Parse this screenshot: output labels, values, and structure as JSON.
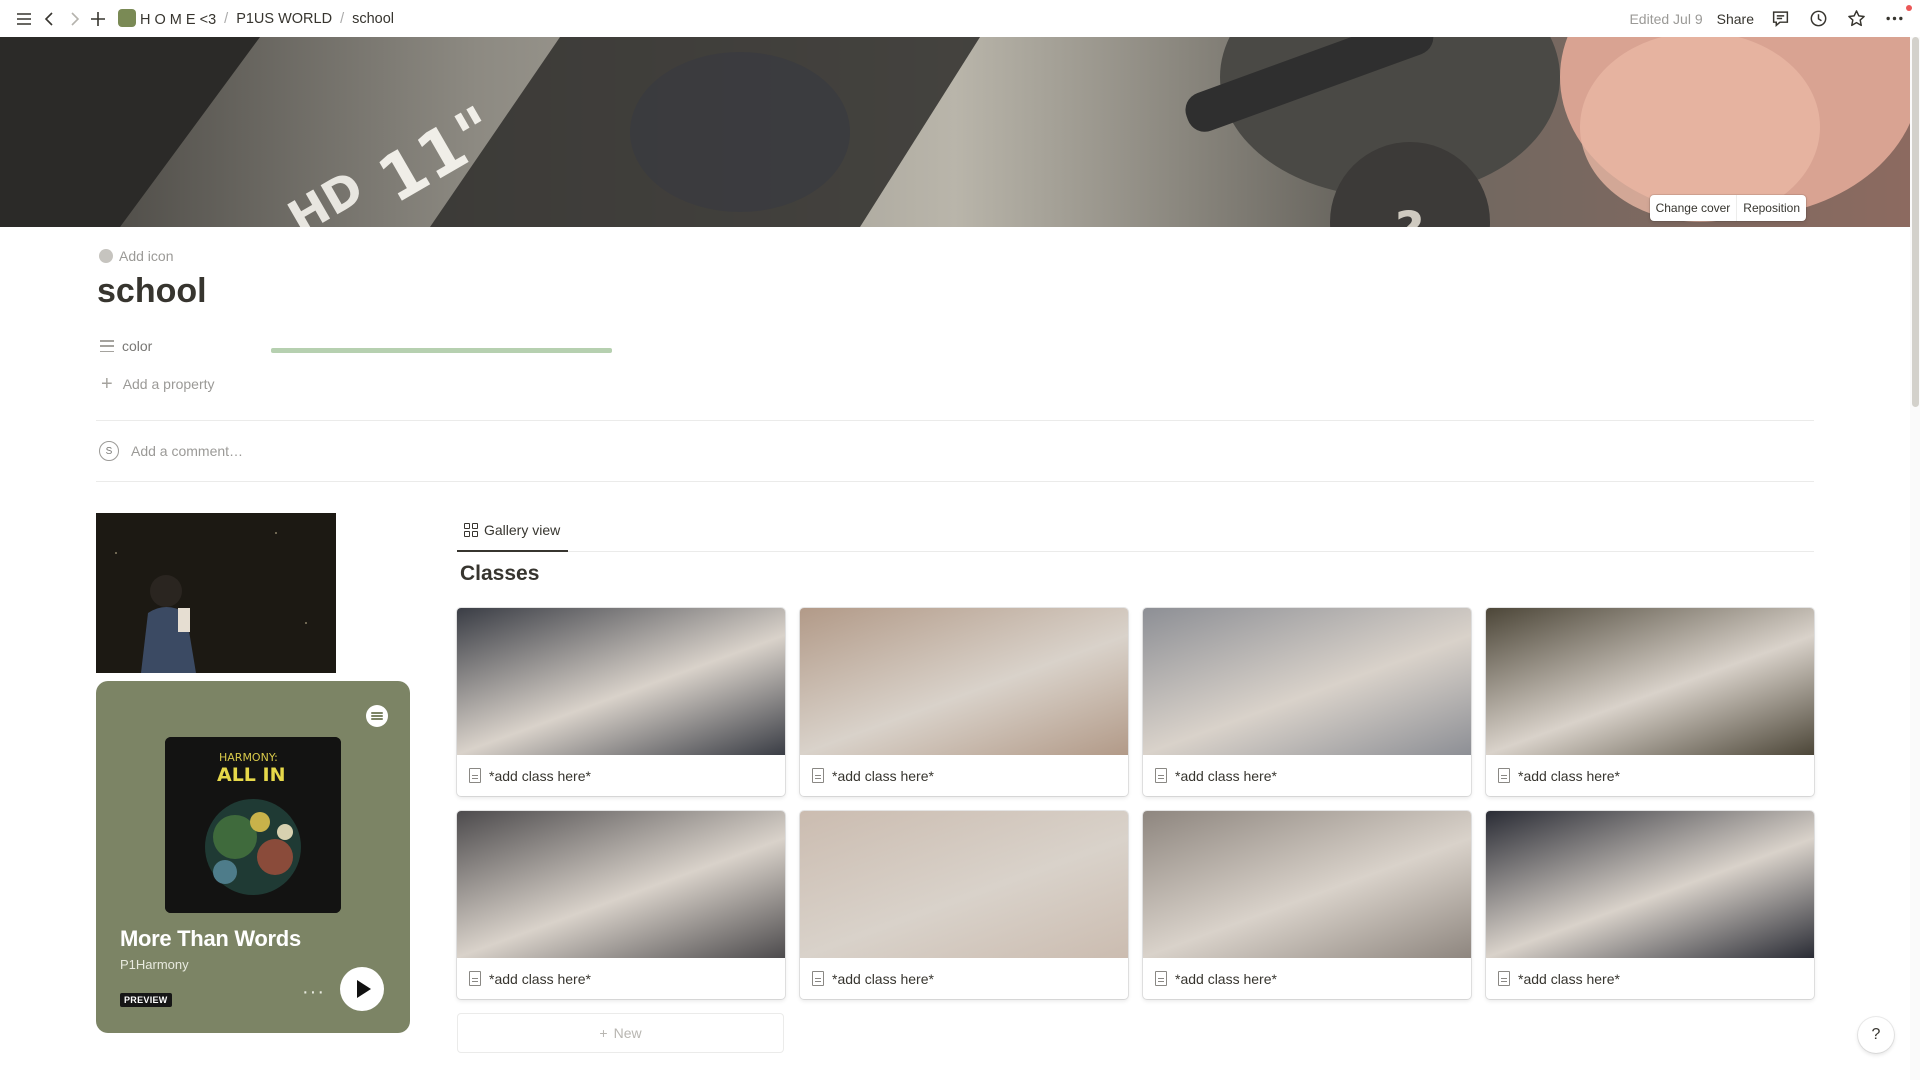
{
  "topbar": {
    "breadcrumbs": [
      "H O M E <3",
      "P1US WORLD",
      "school"
    ],
    "separator": "/",
    "edited": "Edited Jul 9",
    "share": "Share"
  },
  "cover": {
    "change_label": "Change cover",
    "reposition_label": "Reposition",
    "text_hd": "HD",
    "text_size": "11\""
  },
  "page": {
    "add_icon_label": "Add icon",
    "title": "school",
    "property_name": "color",
    "add_property_label": "Add a property",
    "comment_avatar": "S",
    "comment_placeholder": "Add a comment…"
  },
  "spotify": {
    "album_line1": "HARMONY:",
    "album_line2": "ALL IN",
    "track": "More Than Words",
    "artist": "P1Harmony",
    "preview_badge": "PREVIEW",
    "more": "···",
    "bg_color": "#7c8465"
  },
  "database": {
    "view_tab": "Gallery view",
    "title": "Classes",
    "cards": [
      {
        "label": "*add class here*",
        "color": "#3a3d45"
      },
      {
        "label": "*add class here*",
        "color": "#b29a88"
      },
      {
        "label": "*add class here*",
        "color": "#8d8f95"
      },
      {
        "label": "*add class here*",
        "color": "#4c4638"
      },
      {
        "label": "*add class here*",
        "color": "#4d4b4d"
      },
      {
        "label": "*add class here*",
        "color": "#cbbcb0"
      },
      {
        "label": "*add class here*",
        "color": "#8e867f"
      },
      {
        "label": "*add class here*",
        "color": "#2a2c35"
      }
    ],
    "new_label": "New"
  },
  "help": "?"
}
